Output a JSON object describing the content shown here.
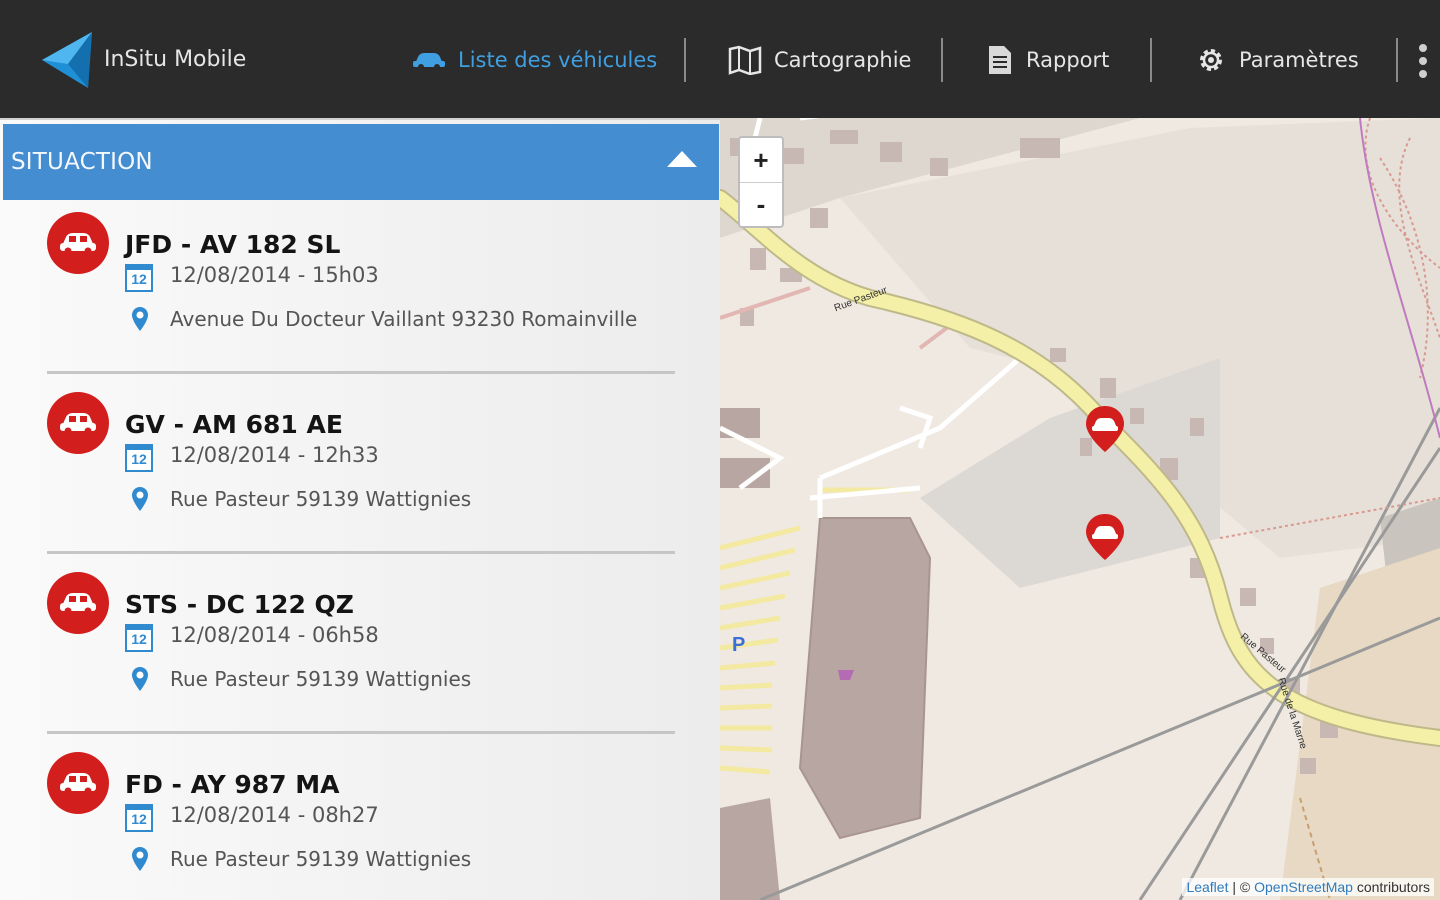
{
  "app": {
    "title": "InSitu Mobile"
  },
  "nav": {
    "vehicles": "Liste des véhicules",
    "map": "Cartographie",
    "report": "Rapport",
    "settings": "Paramètres"
  },
  "panel": {
    "header": "SITUACTION",
    "vehicles": [
      {
        "plate": "JFD - AV 182 SL",
        "date": "12/08/2014 - 15h03",
        "address": "Avenue Du Docteur Vaillant 93230 Romainville"
      },
      {
        "plate": "GV - AM 681 AE",
        "date": "12/08/2014 - 12h33",
        "address": "Rue Pasteur 59139 Wattignies"
      },
      {
        "plate": "STS - DC 122 QZ",
        "date": "12/08/2014 - 06h58",
        "address": "Rue Pasteur 59139 Wattignies"
      },
      {
        "plate": "FD - AY 987 MA",
        "date": "12/08/2014 - 08h27",
        "address": "Rue Pasteur 59139 Wattignies"
      }
    ],
    "calendar_day": "12"
  },
  "map": {
    "zoom_in": "+",
    "zoom_out": "-",
    "attribution_leaflet": "Leaflet",
    "attribution_sep": " | © ",
    "attribution_osm": "OpenStreetMap",
    "attribution_tail": " contributors",
    "street_1": "Rue Pasteur",
    "street_2": "Rue Pasteur",
    "street_3": "Rue de la Marne",
    "parking": "P"
  },
  "colors": {
    "topbar": "#2b2b2b",
    "accent_blue": "#3f9fe0",
    "header_blue": "#438dd0",
    "marker_red": "#d31e1e",
    "road_yellow": "#f4f0a8"
  },
  "icons": {
    "logo": "insitu-logo-icon",
    "vehicles": "car-icon",
    "map": "map-icon",
    "report": "document-icon",
    "settings": "gear-icon",
    "overflow": "overflow-menu-icon",
    "calendar": "calendar-icon",
    "location": "location-pin-icon"
  }
}
